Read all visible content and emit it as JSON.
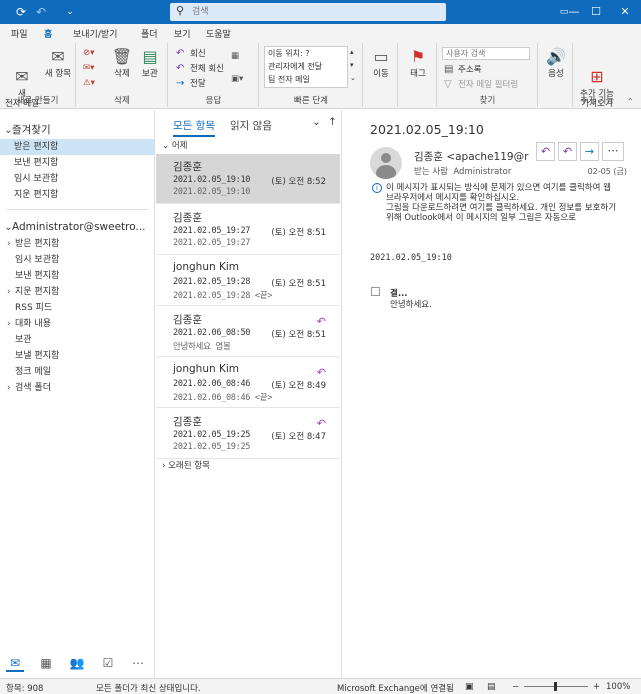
{
  "titlebar": {
    "search_placeholder": "검색",
    "icons": [
      "sync-icon",
      "undo-icon",
      "customize-icon"
    ],
    "window_controls": [
      "minimize",
      "maximize",
      "close"
    ]
  },
  "menu": {
    "items": [
      "파일",
      "홈",
      "보내기/받기",
      "폴더",
      "보기",
      "도움말"
    ],
    "active": "홈"
  },
  "ribbon": {
    "new_email": "새\n전자 메일",
    "new_items": "새 항목",
    "group_new": "새로 만들기",
    "delete": "삭제",
    "archive": "보관",
    "group_delete": "삭제",
    "reply": "회신",
    "reply_all": "전체 회신",
    "forward": "전달",
    "group_respond": "응답",
    "quick_steps": [
      "이동 위치: ?",
      "관리자에게 전달",
      "팀 전자 메일"
    ],
    "group_quicksteps": "빠른 단계",
    "move": "이동",
    "tags": "태그",
    "search_people_placeholder": "사용자 검색",
    "address_book": "주소록",
    "filter_email": "전자 메일 필터링",
    "group_find": "찾기",
    "read_aloud": "음성",
    "addins": "추가 기능\n가져오기",
    "group_addins": "추가 기능"
  },
  "nav": {
    "favorites_header": "즐겨찾기",
    "favorites": [
      "받은 편지함",
      "보낸 편지함",
      "임시 보관함",
      "지운 편지함"
    ],
    "account_header": "Administrator@sweetro...",
    "folders": [
      {
        "label": "받은 편지함",
        "chev": "›"
      },
      {
        "label": "임시 보관함",
        "chev": ""
      },
      {
        "label": "보낸 편지함",
        "chev": ""
      },
      {
        "label": "지운 편지함",
        "chev": "›"
      },
      {
        "label": "RSS 피드",
        "chev": ""
      },
      {
        "label": "대화 내용",
        "chev": "›"
      },
      {
        "label": "보관",
        "chev": ""
      },
      {
        "label": "보낼 편지함",
        "chev": ""
      },
      {
        "label": "정크 메일",
        "chev": ""
      },
      {
        "label": "검색 폴더",
        "chev": "›"
      }
    ],
    "bottom_icons": [
      "mail-icon",
      "calendar-icon",
      "people-icon",
      "tasks-icon",
      "more-icon"
    ]
  },
  "list": {
    "tab_all": "모든 항목",
    "tab_unread": "읽지 않음",
    "group_yesterday": "어제",
    "group_older": "오래된 항목",
    "messages": [
      {
        "from": "김종훈",
        "subject": "2021.02.05_19:10",
        "time": "(토) 오전 8:52",
        "preview": "2021.02.05_19:10",
        "replied": false
      },
      {
        "from": "김종훈",
        "subject": "2021.02.05_19:27",
        "time": "(토) 오전 8:51",
        "preview": "2021.02.05_19:27",
        "replied": false
      },
      {
        "from": "jonghun Kim",
        "subject": "2021.02.05_19:28",
        "time": "(토) 오전 8:51",
        "preview": "2021.02.05_19:28 <끝>",
        "replied": false
      },
      {
        "from": "김종훈",
        "subject": "2021.02.06_08:50",
        "time": "(토) 오전 8:51",
        "preview": "안녕하세요 염볼",
        "replied": true
      },
      {
        "from": "jonghun Kim",
        "subject": "2021.02.06_08:46",
        "time": "(토) 오전 8:49",
        "preview": "2021.02.06_08:46 <끝>",
        "replied": true
      },
      {
        "from": "김종훈",
        "subject": "2021.02.05_19:25",
        "time": "(토) 오전 8:47",
        "preview": "2021.02.05_19:25",
        "replied": true
      }
    ]
  },
  "reading": {
    "title": "2021.02.05_19:10",
    "sender": "김종훈 <apache119@r",
    "recipient_label": "받는 사람",
    "recipient": "Administrator",
    "date": "02-05 (금)",
    "info_lines": [
      "이 메시지가 표시되는 방식에 문제가 있으면 여기를 클릭하여 웹",
      "브라우저에서 메시지를 확인하십시오.",
      "그림을 다운로드하려면 여기를 클릭하세요. 개인 정보를 보호하기",
      "위해 Outlook에서 이 메시지의 일부 그림은 자동으로"
    ],
    "body_date": "2021.02.05_19:10",
    "body_heading": "결...",
    "body_text": "안녕하세요."
  },
  "status": {
    "items": "항목: 908",
    "folders_state": "모든 폴더가 최신 상태입니다.",
    "connection": "Microsoft Exchange에 연결됨",
    "zoom": "100%"
  },
  "colors": {
    "accent": "#0f6cbd",
    "selection": "#cde4f7",
    "reply": "#a43ebf"
  }
}
